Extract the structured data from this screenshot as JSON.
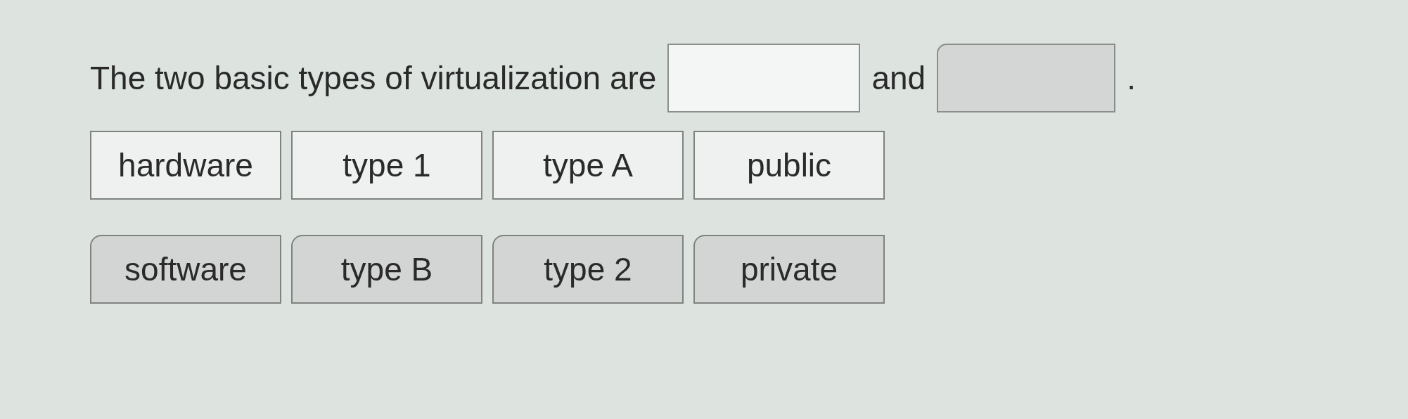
{
  "question": {
    "parts": [
      {
        "kind": "text",
        "text": "The two basic types of virtualization are"
      },
      {
        "kind": "blank",
        "selected": true
      },
      {
        "kind": "text",
        "text": "and"
      },
      {
        "kind": "blank",
        "selected": false
      },
      {
        "kind": "text",
        "text": "."
      }
    ]
  },
  "choice_rows": [
    {
      "tiles": [
        {
          "label": "hardware",
          "kind": "plain"
        },
        {
          "label": "type 1",
          "kind": "plain"
        },
        {
          "label": "type A",
          "kind": "plain"
        },
        {
          "label": "public",
          "kind": "plain"
        }
      ]
    },
    {
      "tiles": [
        {
          "label": "software",
          "kind": "rounded"
        },
        {
          "label": "type B",
          "kind": "rounded"
        },
        {
          "label": "type 2",
          "kind": "rounded"
        },
        {
          "label": "private",
          "kind": "rounded"
        }
      ]
    }
  ]
}
